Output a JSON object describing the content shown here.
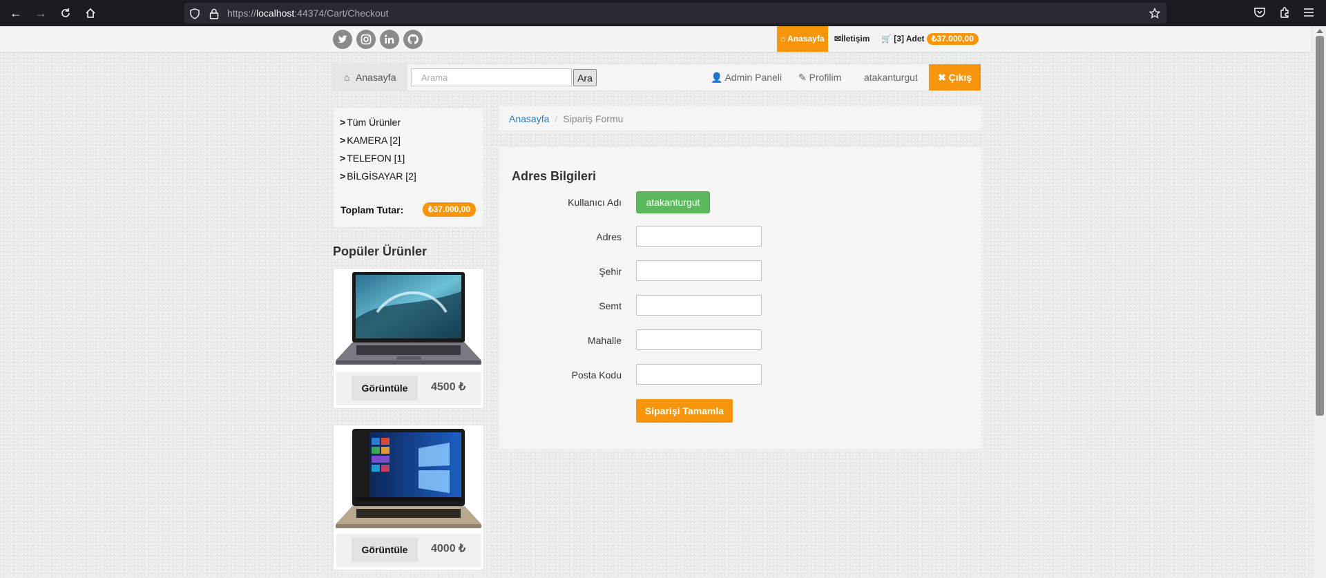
{
  "browser": {
    "url_prefix": "https://",
    "url_host": "localhost",
    "url_rest": ":44374/Cart/Checkout"
  },
  "topbar": {
    "home_label": "Anasayfa",
    "contact_label": "İletişim",
    "cart_label": "[3] Adet",
    "cart_total": "₺37.000,00",
    "social_icons": [
      "twitter-icon",
      "instagram-icon",
      "linkedin-icon",
      "github-icon"
    ]
  },
  "navbar": {
    "home_label": "Anasayfa",
    "search_placeholder": "Arama",
    "search_button": "Ara",
    "admin_label": "Admin Paneli",
    "profile_label": "Profilim",
    "username": "atakanturgut",
    "logout_label": "Çıkış"
  },
  "sidebar": {
    "categories": [
      {
        "label": "Tüm Ürünler"
      },
      {
        "label": "KAMERA [2]"
      },
      {
        "label": "TELEFON [1]"
      },
      {
        "label": "BİLGİSAYAR [2]"
      }
    ],
    "total_label": "Toplam Tutar:",
    "total_value": "₺37.000,00",
    "popular_title": "Popüler Ürünler",
    "products": [
      {
        "view_label": "Görüntüle",
        "price": "4500 ₺"
      },
      {
        "view_label": "Görüntüle",
        "price": "4000 ₺"
      }
    ]
  },
  "breadcrumb": {
    "home": "Anasayfa",
    "current": "Sipariş Formu"
  },
  "form": {
    "title": "Adres Bilgileri",
    "username_label": "Kullanıcı Adı",
    "username_value": "atakanturgut",
    "fields": [
      {
        "label": "Adres",
        "value": ""
      },
      {
        "label": "Şehir",
        "value": ""
      },
      {
        "label": "Semt",
        "value": ""
      },
      {
        "label": "Mahalle",
        "value": ""
      },
      {
        "label": "Posta Kodu",
        "value": ""
      }
    ],
    "submit_label": "Siparişi Tamamla"
  },
  "colors": {
    "accent_orange": "#f7960c",
    "success_green": "#5cb85c",
    "link_blue": "#2a7dc0"
  }
}
